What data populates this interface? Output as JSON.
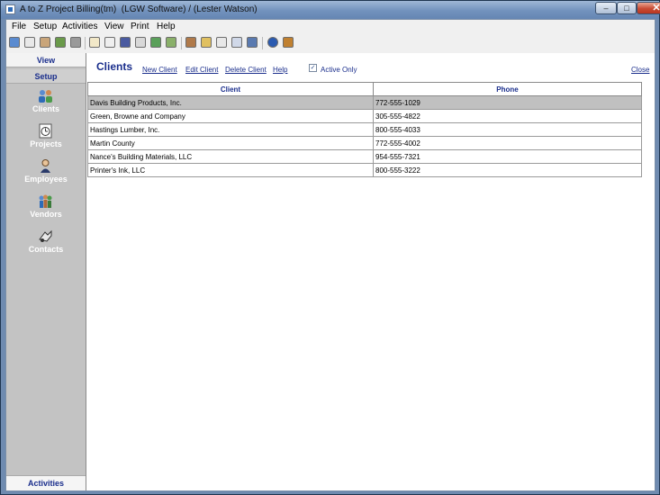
{
  "window": {
    "title": "A to Z Project Billing(tm)  (LGW Software) / (Lester Watson)"
  },
  "menu": [
    "File",
    "Setup",
    "Activities",
    "View",
    "Print",
    "Help"
  ],
  "sidebar": {
    "view_label": "View",
    "setup_label": "Setup",
    "activities_label": "Activities",
    "items": [
      {
        "label": "Clients",
        "icon": "clients-icon"
      },
      {
        "label": "Projects",
        "icon": "projects-icon"
      },
      {
        "label": "Employees",
        "icon": "employees-icon"
      },
      {
        "label": "Vendors",
        "icon": "vendors-icon"
      },
      {
        "label": "Contacts",
        "icon": "contacts-icon"
      }
    ]
  },
  "page": {
    "title": "Clients",
    "new_client": "New Client",
    "edit_client": "Edit Client",
    "delete_client": "Delete Client",
    "help": "Help",
    "active_only": "Active Only",
    "close": "Close"
  },
  "table": {
    "headers": [
      "Client",
      "Phone"
    ],
    "rows": [
      [
        "Davis Building Products, Inc.",
        "772-555-1029"
      ],
      [
        "Green, Browne and Company",
        "305-555-4822"
      ],
      [
        "Hastings Lumber, Inc.",
        "800-555-4033"
      ],
      [
        "Martin County",
        "772-555-4002"
      ],
      [
        "Nance's Building Materials, LLC",
        "954-555-7321"
      ],
      [
        "Printer's Ink, LLC",
        "800-555-3222"
      ]
    ]
  },
  "colors": {
    "accent": "#1a2e8c",
    "sidebar": "#c3c3c3",
    "selected_row": "#c0c0c0"
  }
}
